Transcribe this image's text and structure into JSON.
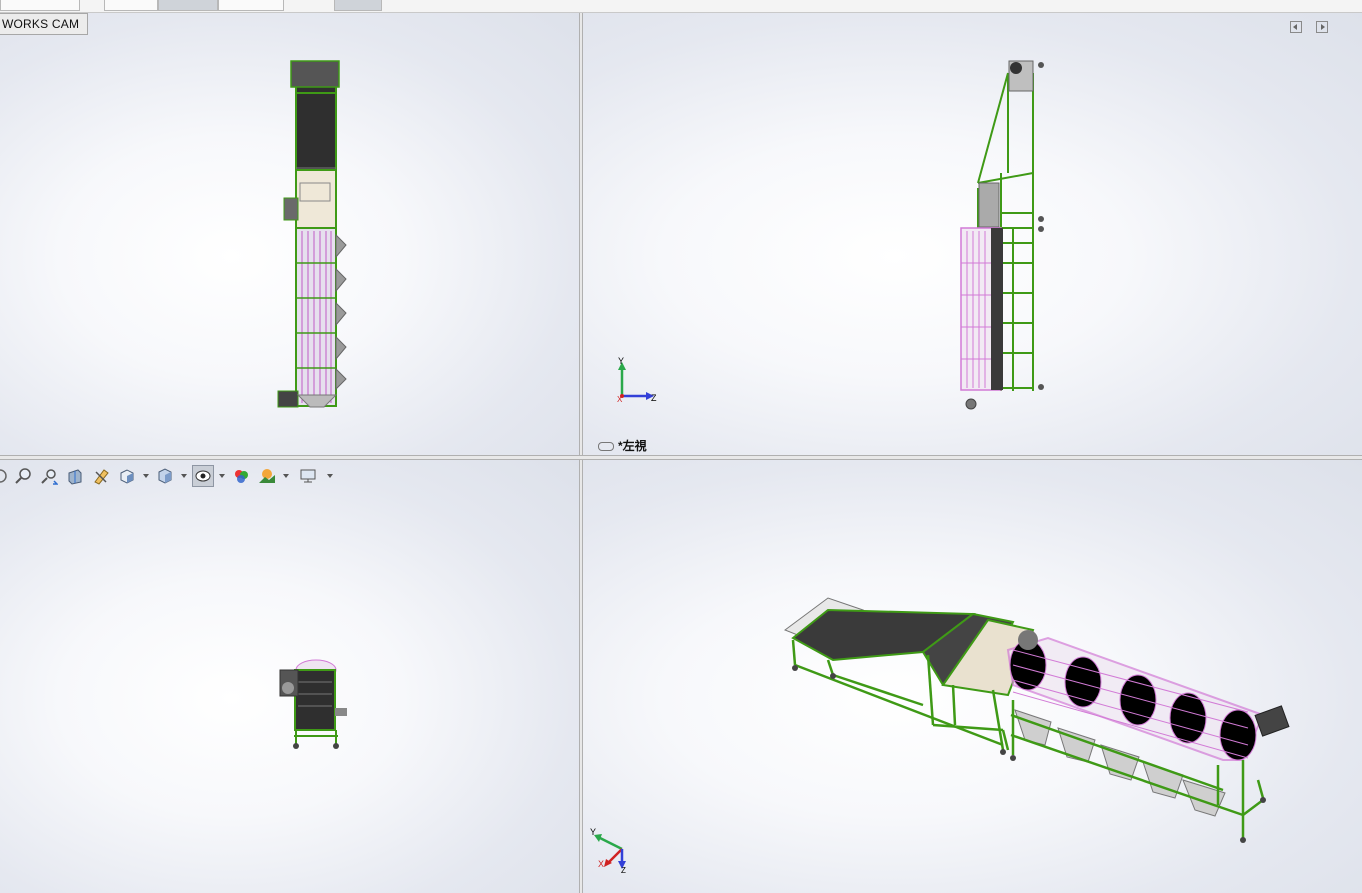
{
  "window": {
    "cam_tab_label": "WORKS CAM"
  },
  "viewports": {
    "front": {
      "name": ""
    },
    "left": {
      "name": "*左視"
    },
    "top": {
      "name": ""
    },
    "isometric": {
      "name": ""
    }
  },
  "triad": {
    "left_view": {
      "x": "X",
      "y": "Y",
      "z": "Z"
    },
    "iso_view": {
      "x": "X",
      "y": "Y",
      "z": "Z"
    }
  },
  "hud_toolbar": {
    "icons": [
      "rotate-icon",
      "zoom-to-area-icon",
      "previous-view-icon",
      "section-view-icon",
      "dynamic-annotation-icon",
      "view-orientation-icon",
      "display-style-icon",
      "hide-show-items-icon",
      "edit-appearance-icon",
      "apply-scene-icon",
      "view-settings-icon"
    ],
    "pressed": "hide-show-items-icon"
  },
  "colors": {
    "frame_green": "#3f9a16",
    "drum_pink": "#d27ad6",
    "belt_dark": "#3a3a3a",
    "accent_triad_y": "#2aa84a",
    "accent_triad_z": "#3340d8",
    "accent_triad_x": "#d02222"
  }
}
